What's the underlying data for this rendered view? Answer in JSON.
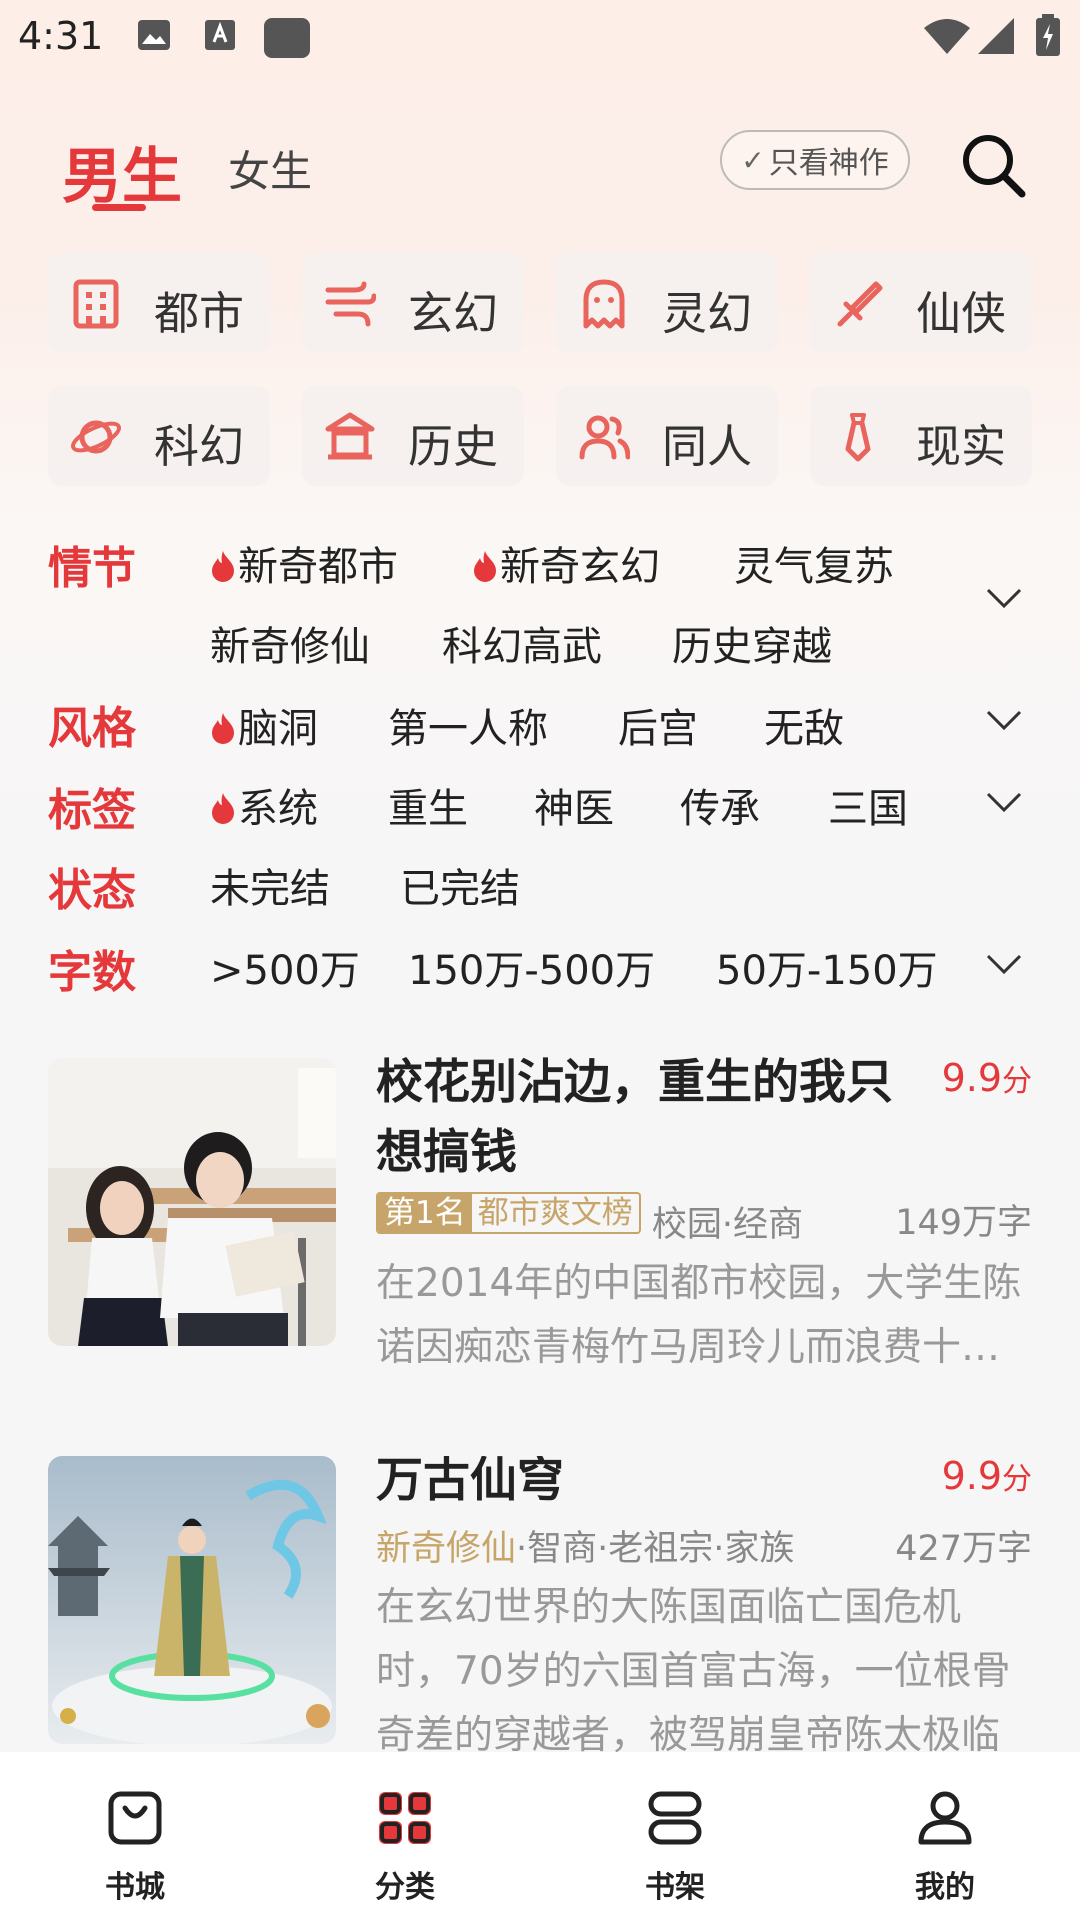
{
  "status_bar": {
    "time": "4:31"
  },
  "top_tabs": {
    "male": "男生",
    "female": "女生",
    "only_masterpiece": "只看神作"
  },
  "genres": [
    {
      "label": "都市",
      "icon": "building-icon"
    },
    {
      "label": "玄幻",
      "icon": "wind-icon"
    },
    {
      "label": "灵幻",
      "icon": "ghost-icon"
    },
    {
      "label": "仙侠",
      "icon": "sword-icon"
    },
    {
      "label": "科幻",
      "icon": "planet-icon"
    },
    {
      "label": "历史",
      "icon": "palace-icon"
    },
    {
      "label": "同人",
      "icon": "people-icon"
    },
    {
      "label": "现实",
      "icon": "tie-icon"
    }
  ],
  "filters": {
    "plot": {
      "label": "情节",
      "options": [
        "新奇都市",
        "新奇玄幻",
        "灵气复苏",
        "新奇修仙",
        "科幻高武",
        "历史穿越"
      ]
    },
    "style": {
      "label": "风格",
      "options": [
        "脑洞",
        "第一人称",
        "后宫",
        "无敌"
      ]
    },
    "tags": {
      "label": "标签",
      "options": [
        "系统",
        "重生",
        "神医",
        "传承",
        "三国"
      ]
    },
    "status": {
      "label": "状态",
      "options": [
        "未完结",
        "已完结"
      ]
    },
    "words": {
      "label": "字数",
      "options": [
        ">500万",
        "150万-500万",
        "50万-150万"
      ]
    }
  },
  "books": [
    {
      "title": "校花别沾边，重生的我只想搞钱",
      "score": "9.9",
      "score_unit": "分",
      "rank": "第1名",
      "rank_list": "都市爽文榜",
      "tags": "校园·经商",
      "words": "149万字",
      "desc": "在2014年的中国都市校园，大学生陈诺因痴恋青梅竹马周玲儿而浪费十年青春……"
    },
    {
      "title": "万古仙穹",
      "score": "9.9",
      "score_unit": "分",
      "main_tag": "新奇修仙",
      "tags": "·智商·老祖宗·家族",
      "words": "427万字",
      "desc": "在玄幻世界的大陈国面临亡国危机时，70岁的六国首富古海，一位根骨奇差的穿越者，被驾崩皇帝陈太极临"
    }
  ],
  "bottom_nav": [
    {
      "label": "书城",
      "icon": "bag-icon"
    },
    {
      "label": "分类",
      "icon": "grid-icon"
    },
    {
      "label": "书架",
      "icon": "shelf-icon"
    },
    {
      "label": "我的",
      "icon": "user-icon"
    }
  ],
  "colors": {
    "accent": "#e5383b",
    "gold": "#c7a56a"
  }
}
